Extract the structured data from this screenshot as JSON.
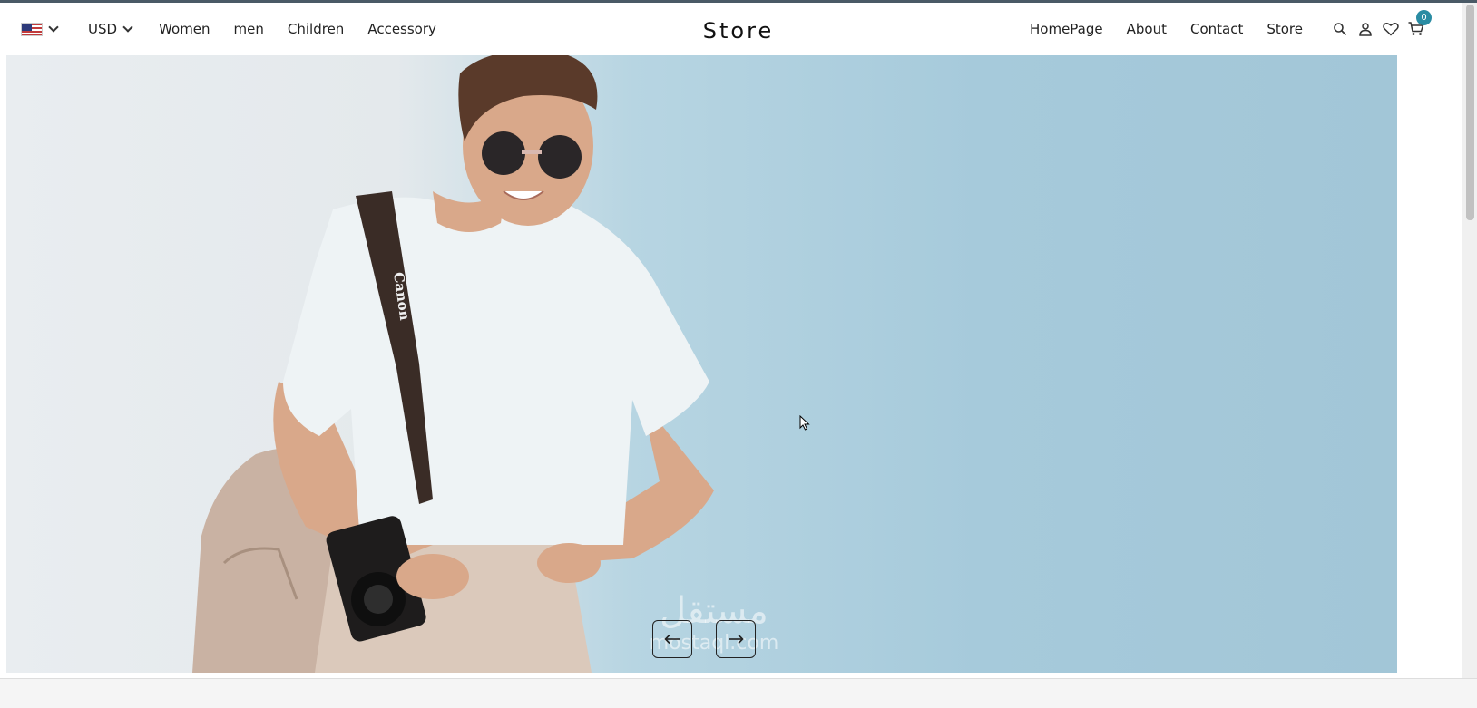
{
  "header": {
    "flag_icon": "us-flag-icon",
    "currency": "USD",
    "left_links": [
      "Women",
      "men",
      "Children",
      "Accessory"
    ],
    "brand": "Store",
    "right_links": [
      "HomePage",
      "About",
      "Contact",
      "Store"
    ],
    "icons": [
      "search-icon",
      "user-icon",
      "heart-icon",
      "cart-icon"
    ],
    "cart_count": "0",
    "accent_color": "#2a8ca3"
  },
  "hero": {
    "background_colors": [
      "#e4e9ec",
      "#a6cadb"
    ],
    "prev_icon": "arrow-left-icon",
    "next_icon": "arrow-right-icon",
    "watermark": "مستقل",
    "watermark_sub": "mostaql.com"
  }
}
